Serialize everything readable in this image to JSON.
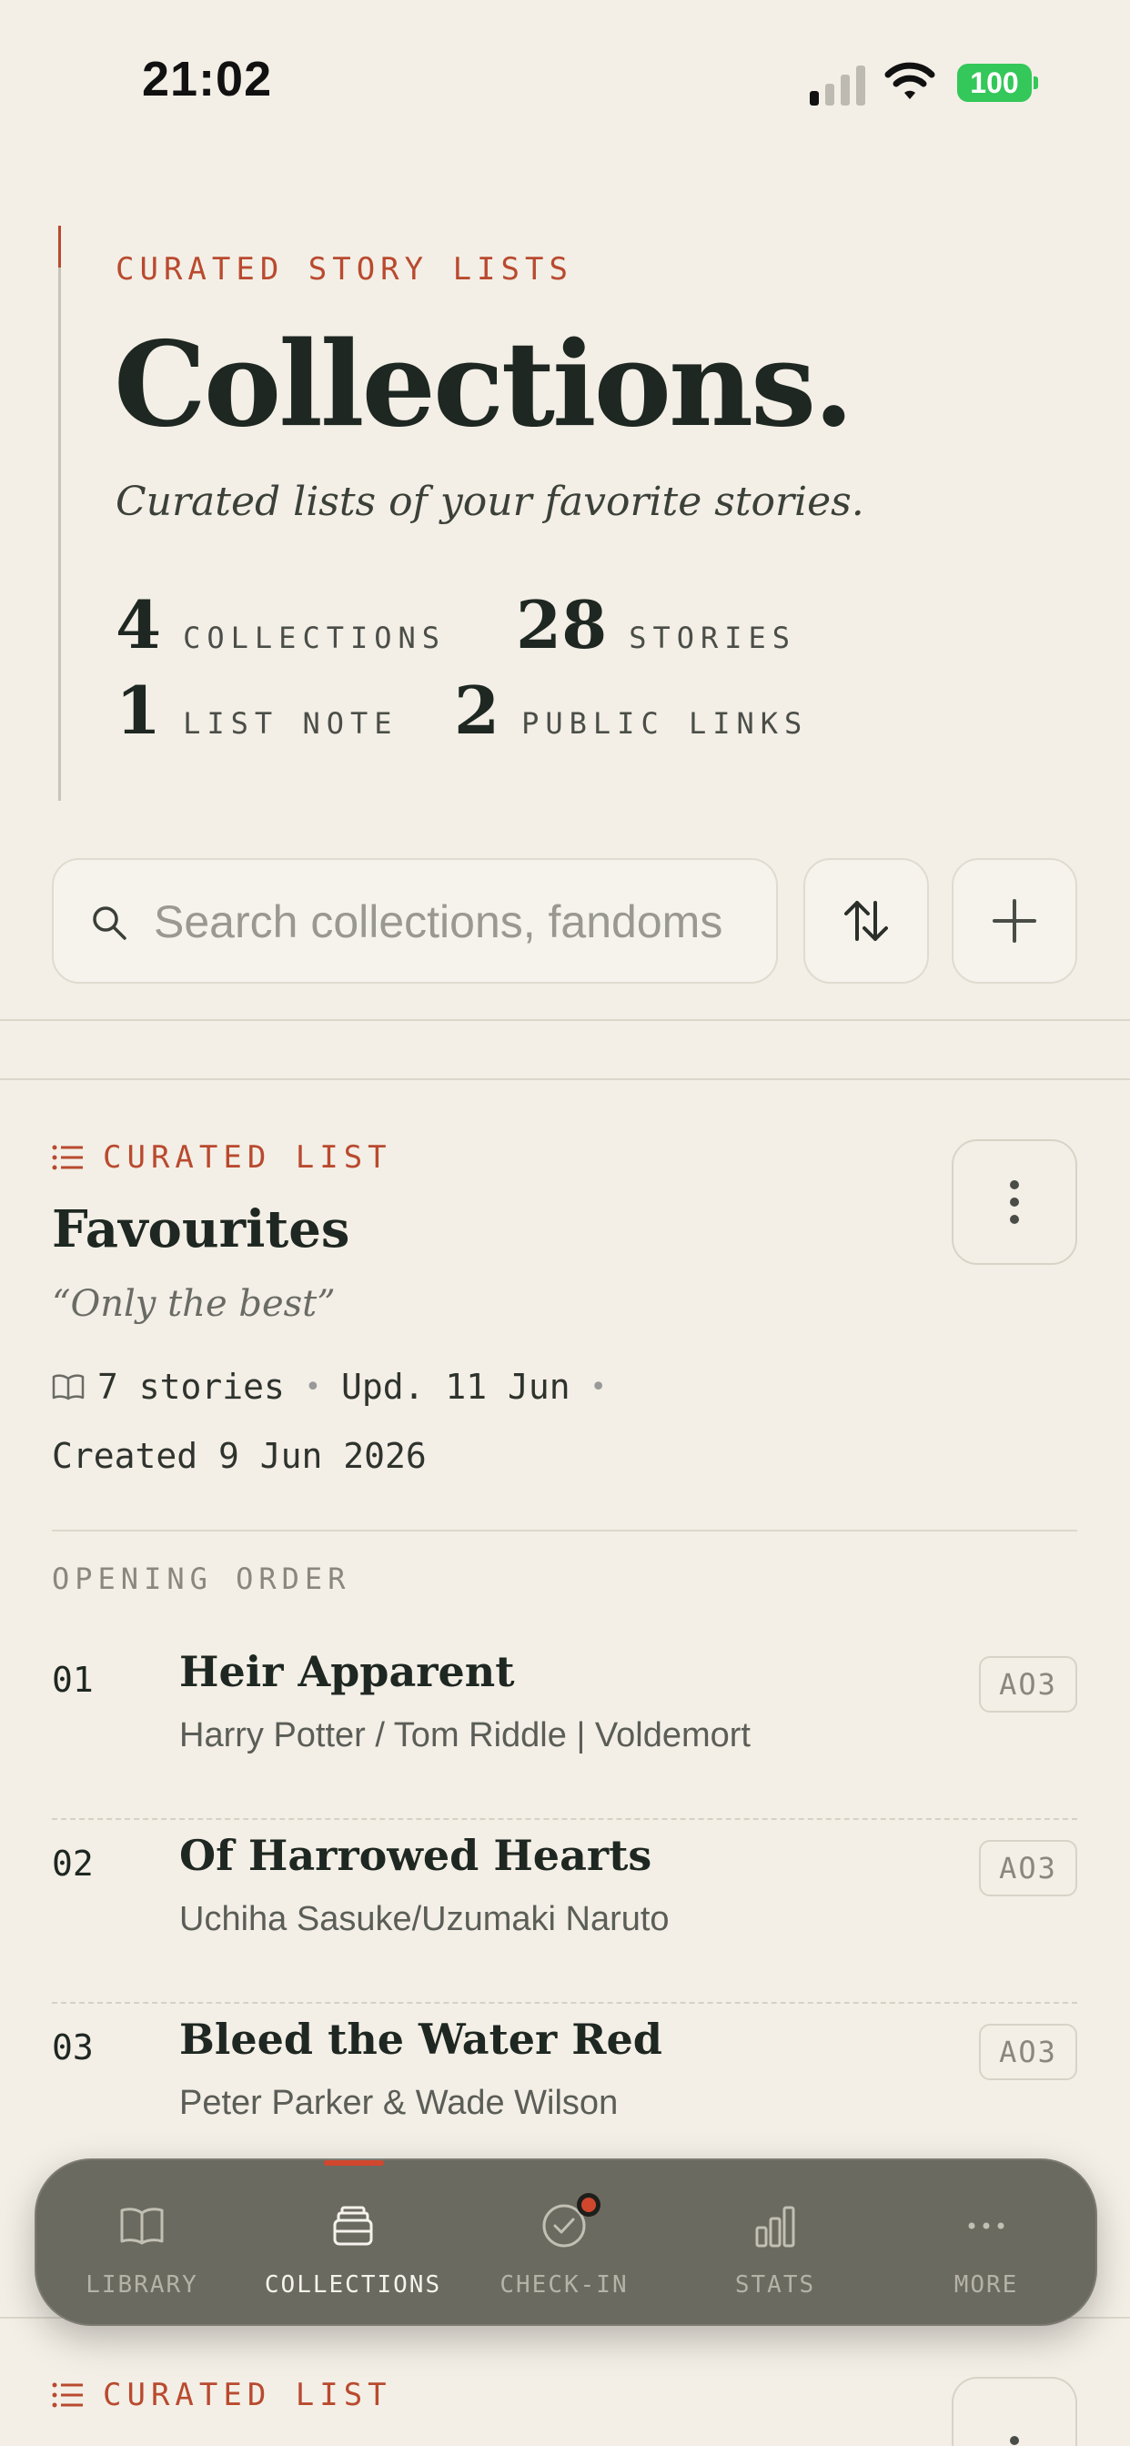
{
  "status_bar": {
    "time": "21:02",
    "battery": "100"
  },
  "hero": {
    "eyebrow": "CURATED STORY LISTS",
    "title": "Collections.",
    "subtitle": "Curated lists of your favorite stories.",
    "stats": [
      {
        "value": "4",
        "label": "COLLECTIONS"
      },
      {
        "value": "28",
        "label": "STORIES"
      },
      {
        "value": "1",
        "label": "LIST NOTE"
      },
      {
        "value": "2",
        "label": "PUBLIC LINKS"
      }
    ]
  },
  "search": {
    "placeholder": "Search collections, fandoms"
  },
  "collections": [
    {
      "type_label": "CURATED LIST",
      "title": "Favourites",
      "quote": "“Only the best”",
      "story_count": "7 stories",
      "updated": "Upd. 11 Jun",
      "created": "Created 9 Jun 2026",
      "section_label": "OPENING ORDER",
      "stories": [
        {
          "num": "01",
          "title": "Heir Apparent",
          "fandom": "Harry Potter / Tom Riddle | Voldemort",
          "source": "AO3"
        },
        {
          "num": "02",
          "title": "Of Harrowed Hearts",
          "fandom": "Uchiha Sasuke/Uzumaki Naruto",
          "source": "AO3"
        },
        {
          "num": "03",
          "title": "Bleed the Water Red",
          "fandom": "Peter Parker & Wade Wilson",
          "source": "AO3"
        }
      ]
    },
    {
      "type_label": "CURATED LIST"
    }
  ],
  "tab_bar": {
    "tabs": [
      {
        "label": "LIBRARY",
        "icon": "book-icon"
      },
      {
        "label": "COLLECTIONS",
        "icon": "stack-icon",
        "active": true
      },
      {
        "label": "CHECK-IN",
        "icon": "check-circle-icon"
      },
      {
        "label": "STATS",
        "icon": "bar-chart-icon"
      },
      {
        "label": "MORE",
        "icon": "ellipsis-icon"
      }
    ]
  },
  "colors": {
    "background": "#f3efe6",
    "accent": "#b94a2f",
    "ink": "#1e2721",
    "tab_bar": "#6b6a61",
    "battery": "#34c759"
  }
}
